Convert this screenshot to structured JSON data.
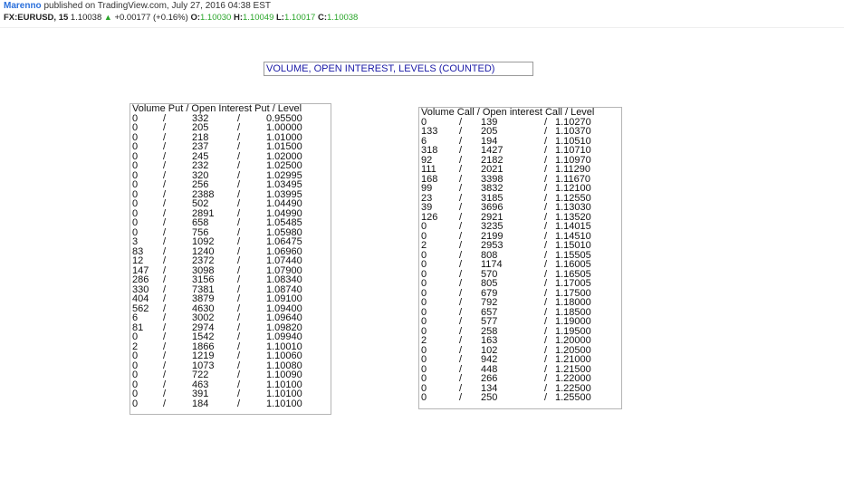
{
  "header": {
    "author": "Marenno",
    "published_text": " published on TradingView.com, July 27, 2016 04:38 EST",
    "symbol": "FX:EURUSD, 15",
    "price": "1.10038",
    "change": "+0.00177 (+0.16%)",
    "open_label": "O:",
    "open_value": "1.10030",
    "high_label": "H:",
    "high_value": "1.10049",
    "low_label": "L:",
    "low_value": "1.10017",
    "close_label": "C:",
    "close_value": "1.10038"
  },
  "title": "VOLUME, OPEN INTEREST, LEVELS (COUNTED)",
  "put_table": {
    "header": "Volume Put / Open Interest Put / Level",
    "rows": [
      [
        "0",
        "332",
        "0.95500"
      ],
      [
        "0",
        "205",
        "1.00000"
      ],
      [
        "0",
        "218",
        "1.01000"
      ],
      [
        "0",
        "237",
        "1.01500"
      ],
      [
        "0",
        "245",
        "1.02000"
      ],
      [
        "0",
        "232",
        "1.02500"
      ],
      [
        "0",
        "320",
        "1.02995"
      ],
      [
        "0",
        "256",
        "1.03495"
      ],
      [
        "0",
        "2388",
        "1.03995"
      ],
      [
        "0",
        "502",
        "1.04490"
      ],
      [
        "0",
        "2891",
        "1.04990"
      ],
      [
        "0",
        "658",
        "1.05485"
      ],
      [
        "0",
        "756",
        "1.05980"
      ],
      [
        "3",
        "1092",
        "1.06475"
      ],
      [
        "83",
        "1240",
        "1.06960"
      ],
      [
        "12",
        "2372",
        "1.07440"
      ],
      [
        "147",
        "3098",
        "1.07900"
      ],
      [
        "286",
        "3156",
        "1.08340"
      ],
      [
        "330",
        "7381",
        "1.08740"
      ],
      [
        "404",
        "3879",
        "1.09100"
      ],
      [
        "562",
        "4630",
        "1.09400"
      ],
      [
        "6",
        "3002",
        "1.09640"
      ],
      [
        "81",
        "2974",
        "1.09820"
      ],
      [
        "0",
        "1542",
        "1.09940"
      ],
      [
        "2",
        "1866",
        "1.10010"
      ],
      [
        "0",
        "1219",
        "1.10060"
      ],
      [
        "0",
        "1073",
        "1.10080"
      ],
      [
        "0",
        "722",
        "1.10090"
      ],
      [
        "0",
        "463",
        "1.10100"
      ],
      [
        "0",
        "391",
        "1.10100"
      ],
      [
        "0",
        "184",
        "1.10100"
      ]
    ]
  },
  "call_table": {
    "header": "Volume Call / Open interest Call / Level",
    "rows": [
      [
        "0",
        "139",
        "1.10270"
      ],
      [
        "133",
        "205",
        "1.10370"
      ],
      [
        "6",
        "194",
        "1.10510"
      ],
      [
        "318",
        "1427",
        "1.10710"
      ],
      [
        "92",
        "2182",
        "1.10970"
      ],
      [
        "111",
        "2021",
        "1.11290"
      ],
      [
        "168",
        "3398",
        "1.11670"
      ],
      [
        "99",
        "3832",
        "1.12100"
      ],
      [
        "23",
        "3185",
        "1.12550"
      ],
      [
        "39",
        "3696",
        "1.13030"
      ],
      [
        "126",
        "2921",
        "1.13520"
      ],
      [
        "0",
        "3235",
        "1.14015"
      ],
      [
        "0",
        "2199",
        "1.14510"
      ],
      [
        "2",
        "2953",
        "1.15010"
      ],
      [
        "0",
        "808",
        "1.15505"
      ],
      [
        "0",
        "1174",
        "1.16005"
      ],
      [
        "0",
        "570",
        "1.16505"
      ],
      [
        "0",
        "805",
        "1.17005"
      ],
      [
        "0",
        "679",
        "1.17500"
      ],
      [
        "0",
        "792",
        "1.18000"
      ],
      [
        "0",
        "657",
        "1.18500"
      ],
      [
        "0",
        "577",
        "1.19000"
      ],
      [
        "0",
        "258",
        "1.19500"
      ],
      [
        "2",
        "163",
        "1.20000"
      ],
      [
        "0",
        "102",
        "1.20500"
      ],
      [
        "0",
        "942",
        "1.21000"
      ],
      [
        "0",
        "448",
        "1.21500"
      ],
      [
        "0",
        "266",
        "1.22000"
      ],
      [
        "0",
        "134",
        "1.22500"
      ],
      [
        "0",
        "250",
        "1.25500"
      ]
    ]
  },
  "separator": "/",
  "colors": {
    "author": "#2a6fdb",
    "up": "#2aa52a",
    "title_text": "#1a1aa6"
  }
}
